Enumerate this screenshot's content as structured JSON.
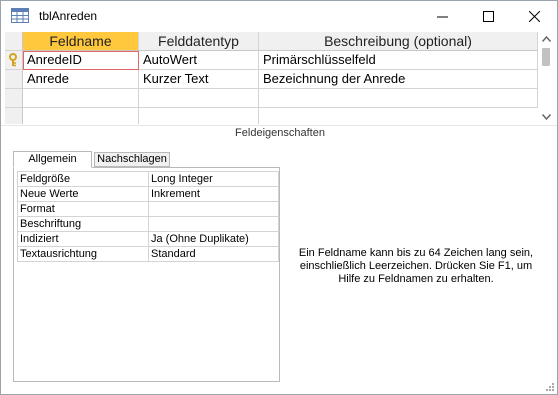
{
  "window": {
    "title": "tblAnreden",
    "icon": "table-icon"
  },
  "controls": {
    "minimize_icon": "minimize-icon",
    "maximize_icon": "maximize-icon",
    "close_icon": "close-icon"
  },
  "grid": {
    "columns": [
      "Feldname",
      "Felddatentyp",
      "Beschreibung (optional)"
    ],
    "rows": [
      {
        "key": true,
        "name": "AnredeID",
        "type": "AutoWert",
        "description": "Primärschlüsselfeld"
      },
      {
        "key": false,
        "name": "Anrede",
        "type": "Kurzer Text",
        "description": "Bezeichnung der Anrede"
      }
    ]
  },
  "properties": {
    "section_title": "Feldeigenschaften",
    "tabs": [
      "Allgemein",
      "Nachschlagen"
    ],
    "active_tab": "Allgemein",
    "rows": [
      {
        "name": "Feldgröße",
        "value": "Long Integer"
      },
      {
        "name": "Neue Werte",
        "value": "Inkrement"
      },
      {
        "name": "Format",
        "value": ""
      },
      {
        "name": "Beschriftung",
        "value": ""
      },
      {
        "name": "Indiziert",
        "value": "Ja (Ohne Duplikate)"
      },
      {
        "name": "Textausrichtung",
        "value": "Standard"
      }
    ],
    "help_text": "Ein Feldname kann bis zu 64 Zeichen lang sein, einschließlich Leerzeichen. Drücken Sie F1, um Hilfe zu Feldnamen zu erhalten."
  },
  "colors": {
    "active_header": "#ffc83d",
    "header_bg": "#f0f0f0",
    "focus_border": "#e06868",
    "key_icon": "#d6a21e"
  }
}
